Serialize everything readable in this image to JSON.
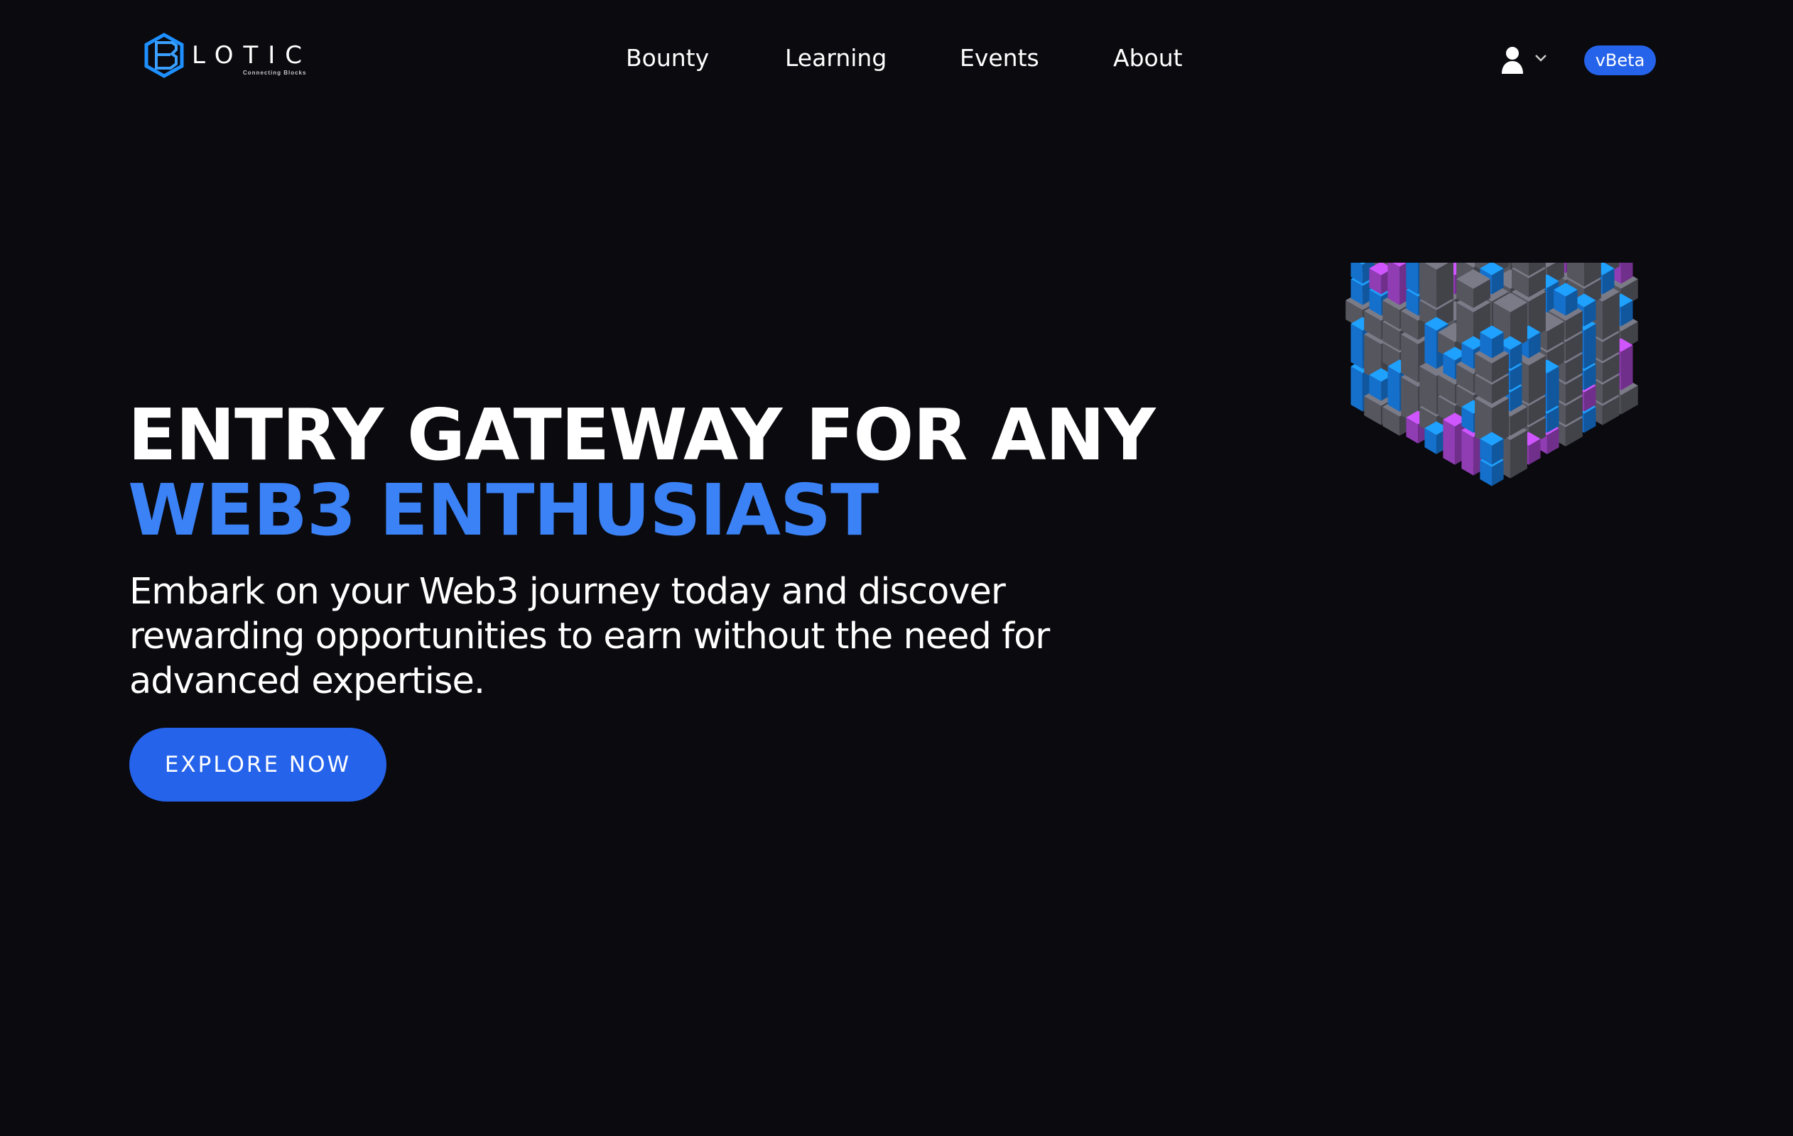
{
  "brand": {
    "name": "LOTIC",
    "tagline": "Connecting Blocks"
  },
  "nav": {
    "links": [
      {
        "label": "Bounty"
      },
      {
        "label": "Learning"
      },
      {
        "label": "Events"
      },
      {
        "label": "About"
      }
    ],
    "user_icon": "user-icon",
    "dropdown_icon": "chevron-down-icon",
    "version_badge": "vBeta"
  },
  "hero": {
    "title_line1": "ENTRY GATEWAY FOR ANY",
    "title_line2": "WEB3 ENTHUSIAST",
    "subtitle": "Embark on your Web3 journey today and discover rewarding opportunities to earn without the need for advanced expertise.",
    "cta_label": "EXPLORE NOW",
    "illustration": "isometric-block-cube"
  },
  "colors": {
    "background": "#0a0a0f",
    "accent": "#2563eb",
    "accent_text": "#3b82f6",
    "cube_gray": "#6b6b76",
    "cube_blue": "#1a8cff",
    "cube_purple": "#b44be0"
  }
}
